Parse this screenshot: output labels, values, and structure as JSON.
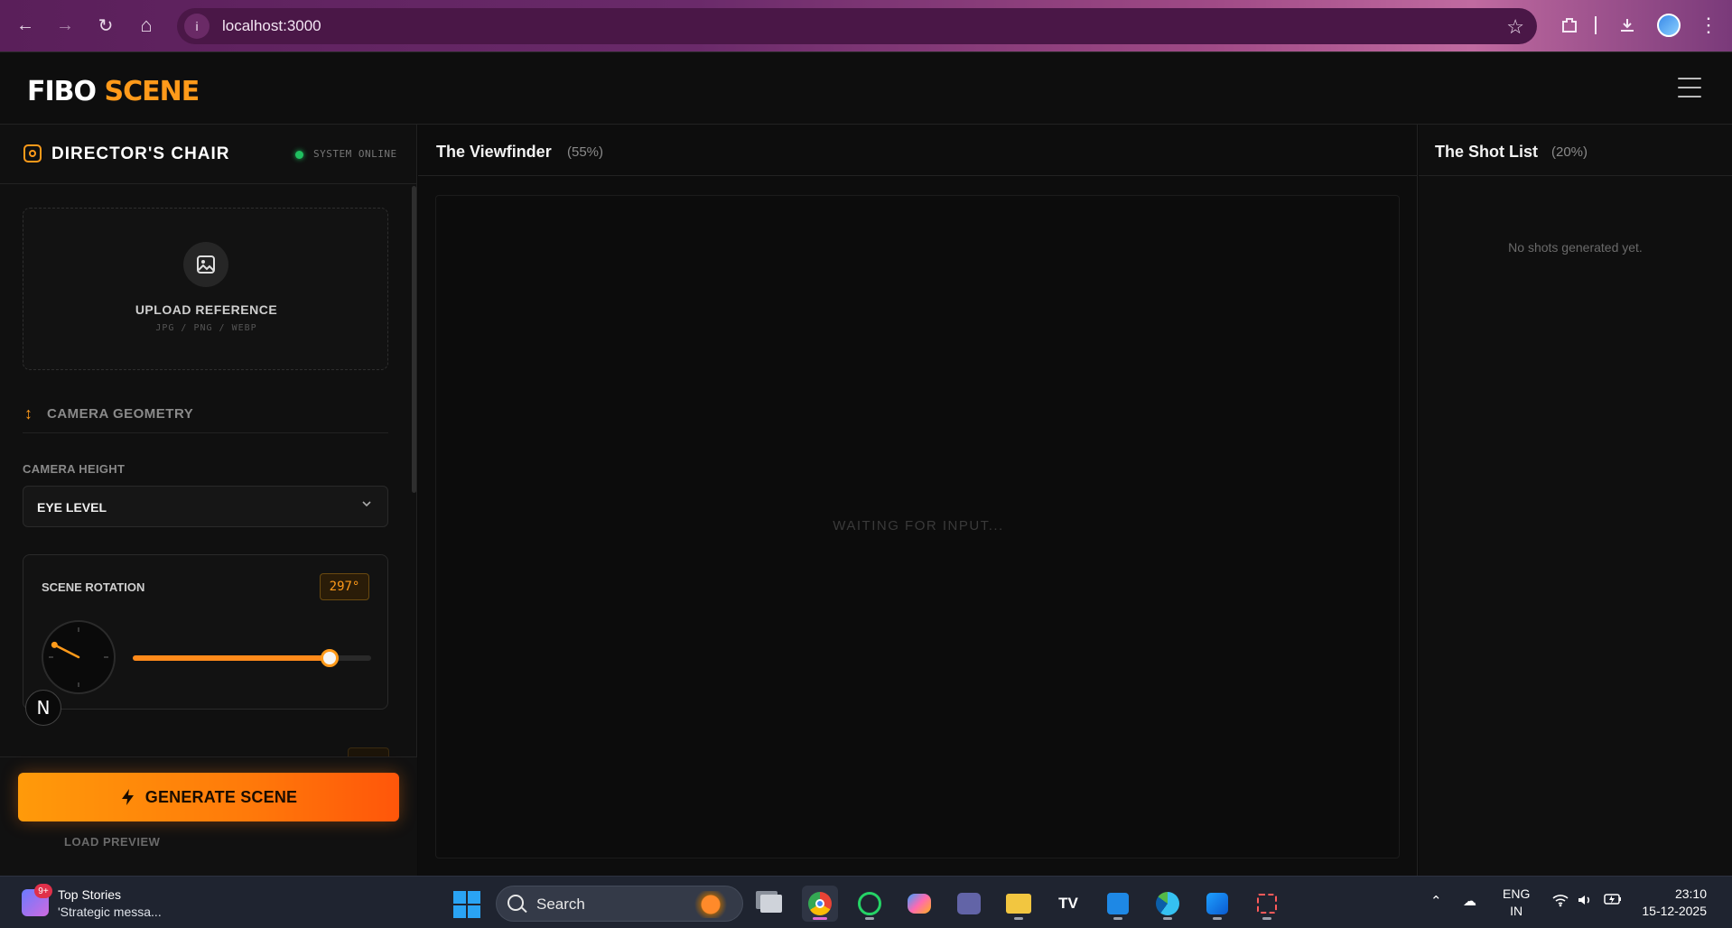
{
  "browser": {
    "url": "localhost:3000",
    "back_icon": "←",
    "forward_icon": "→",
    "reload_icon": "↻",
    "home_icon": "⌂",
    "star_icon": "☆"
  },
  "header": {
    "logo_word1": "FIBO",
    "logo_word2": "SCENE"
  },
  "left_panel": {
    "title": "DIRECTOR'S CHAIR",
    "status": "SYSTEM ONLINE",
    "upload": {
      "title": "UPLOAD REFERENCE",
      "formats": "JPG / PNG / WEBP"
    },
    "section": {
      "icon": "↕",
      "label": "CAMERA GEOMETRY"
    },
    "camera_height": {
      "label": "CAMERA HEIGHT",
      "value": "EYE LEVEL"
    },
    "rotation": {
      "label": "SCENE ROTATION",
      "value_text": "297°",
      "degrees": 297,
      "slider_fraction": 0.825
    },
    "generate_label": "GENERATE SCENE",
    "load_preview_label": "LOAD PREVIEW"
  },
  "viewfinder": {
    "title": "The Viewfinder",
    "pct": "(55%)",
    "placeholder": "WAITING FOR INPUT..."
  },
  "shotlist": {
    "title": "The Shot List",
    "pct": "(20%)",
    "empty": "No shots generated yet."
  },
  "next_badge": "N",
  "taskbar": {
    "news_title": "Top Stories",
    "news_sub": "'Strategic messa...",
    "news_badge": "9+",
    "search_label": "Search",
    "lang_line1": "ENG",
    "lang_line2": "IN",
    "time": "23:10",
    "date": "15-12-2025"
  },
  "colors": {
    "accent": "#ff9a1a",
    "status_online": "#20c060"
  }
}
